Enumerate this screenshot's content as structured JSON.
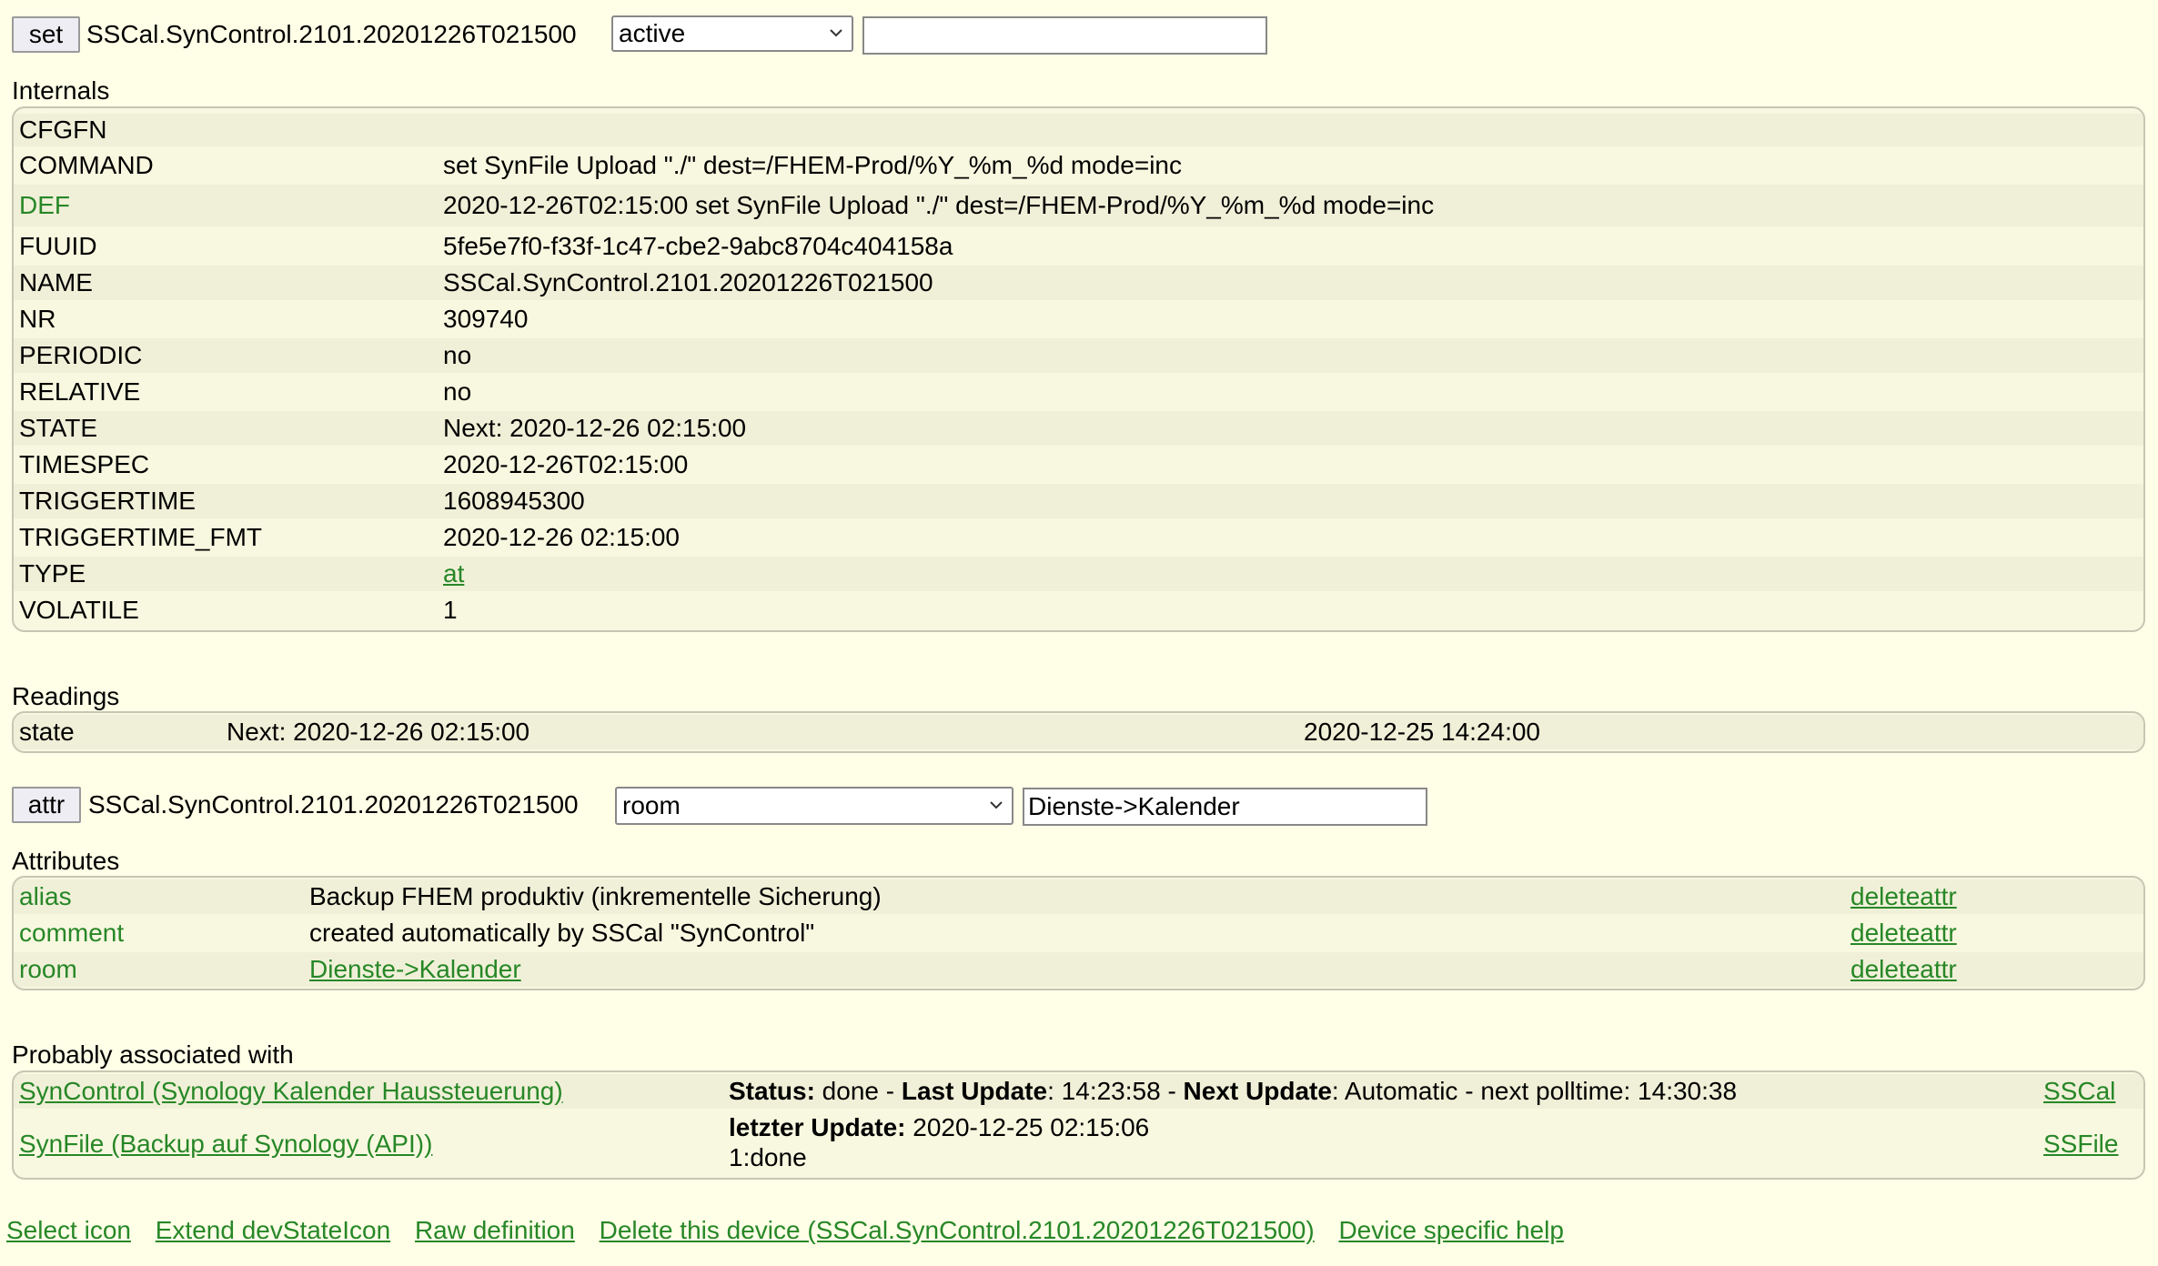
{
  "set_bar": {
    "button": "set",
    "device": "SSCal.SynControl.2101.20201226T021500",
    "select_value": "active",
    "input_value": ""
  },
  "internals": {
    "label": "Internals",
    "rows": [
      {
        "name": "CFGFN",
        "value": ""
      },
      {
        "name": "COMMAND",
        "value": "set SynFile Upload \"./\" dest=/FHEM-Prod/%Y_%m_%d mode=inc"
      },
      {
        "name": "DEF",
        "value": "2020-12-26T02:15:00 set SynFile Upload \"./\" dest=/FHEM-Prod/%Y_%m_%d mode=inc"
      },
      {
        "name": "FUUID",
        "value": "5fe5e7f0-f33f-1c47-cbe2-9abc8704c404158a"
      },
      {
        "name": "NAME",
        "value": "SSCal.SynControl.2101.20201226T021500"
      },
      {
        "name": "NR",
        "value": "309740"
      },
      {
        "name": "PERIODIC",
        "value": "no"
      },
      {
        "name": "RELATIVE",
        "value": "no"
      },
      {
        "name": "STATE",
        "value": "Next: 2020-12-26 02:15:00"
      },
      {
        "name": "TIMESPEC",
        "value": "2020-12-26T02:15:00"
      },
      {
        "name": "TRIGGERTIME",
        "value": "1608945300"
      },
      {
        "name": "TRIGGERTIME_FMT",
        "value": "2020-12-26 02:15:00"
      },
      {
        "name": "TYPE",
        "value": "at"
      },
      {
        "name": "VOLATILE",
        "value": "1"
      }
    ]
  },
  "readings": {
    "label": "Readings",
    "rows": [
      {
        "name": "state",
        "value": "Next: 2020-12-26 02:15:00",
        "time": "2020-12-25 14:24:00"
      }
    ]
  },
  "attr_bar": {
    "button": "attr",
    "device": "SSCal.SynControl.2101.20201226T021500",
    "select_value": "room",
    "input_value": "Dienste->Kalender"
  },
  "attributes": {
    "label": "Attributes",
    "rows": [
      {
        "name": "alias",
        "value": "Backup FHEM produktiv (inkrementelle Sicherung)",
        "action": "deleteattr"
      },
      {
        "name": "comment",
        "value": "created automatically by SSCal \"SynControl\"",
        "action": "deleteattr"
      },
      {
        "name": "room",
        "value": "Dienste->Kalender",
        "action": "deleteattr"
      }
    ]
  },
  "associated": {
    "label": "Probably associated with",
    "rows": [
      {
        "name": "SynControl (Synology Kalender Haussteuerung)",
        "status_label": "Status:",
        "status_value": " done - ",
        "last_label": "Last Update",
        "last_value": ": 14:23:58 - ",
        "next_label": "Next Update",
        "next_value": ": Automatic - next polltime: 14:30:38",
        "type": "SSCal"
      },
      {
        "name": "SynFile (Backup auf Synology (API))",
        "update_label": "letzter Update:",
        "update_value": " 2020-12-25 02:15:06",
        "line2": "1:done",
        "type": "SSFile"
      }
    ]
  },
  "footer_links": [
    "Select icon",
    "Extend devStateIcon",
    "Raw definition",
    "Delete this device (SSCal.SynControl.2101.20201226T021500)",
    "Device specific help"
  ],
  "colors": {
    "background": "#FFFFE7",
    "link": "#278727"
  }
}
